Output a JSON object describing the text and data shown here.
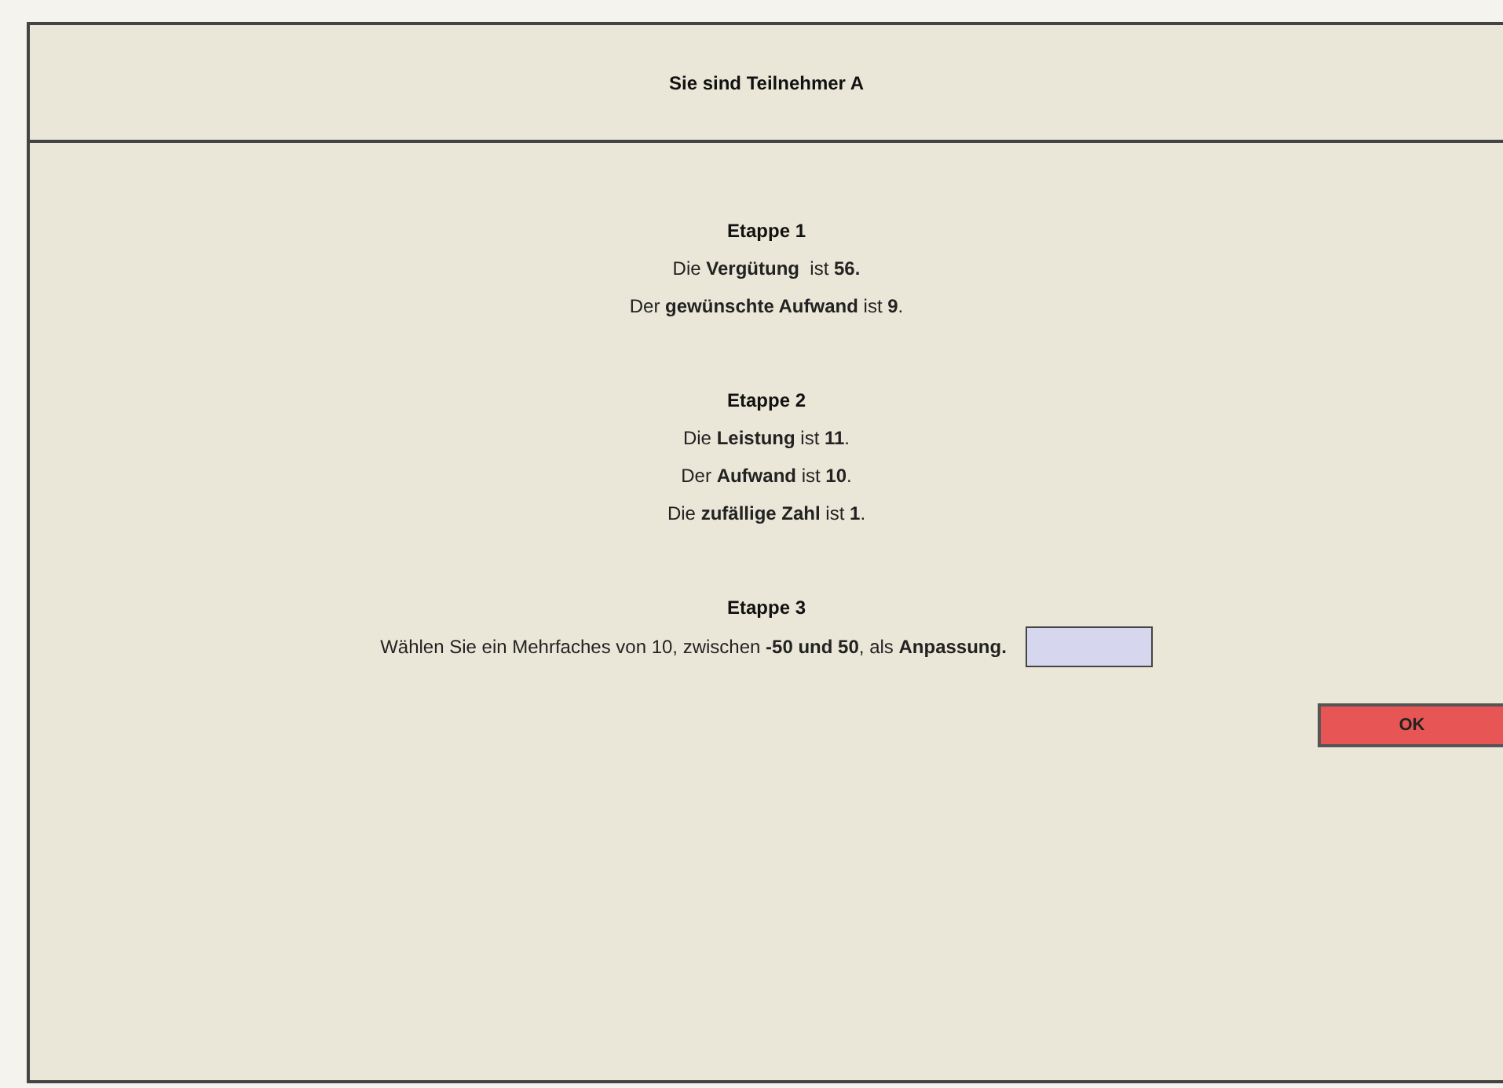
{
  "header": {
    "title": "Sie sind Teilnehmer A"
  },
  "stages": [
    {
      "title": "Etappe 1",
      "lines": [
        "Die **Vergütung**  ist **56.**",
        "Der **gewünschte Aufwand** ist **9**."
      ]
    },
    {
      "title": "Etappe 2",
      "lines": [
        "Die **Leistung** ist **11**.",
        "Der **Aufwand** ist **10**.",
        "Die **zufällige Zahl** ist **1**."
      ]
    },
    {
      "title": "Etappe 3",
      "prompt": "Wählen Sie ein Mehrfaches von 10, zwischen **-50 und 50**, als **Anpassung.**"
    }
  ],
  "ok_button": {
    "label": "OK"
  }
}
